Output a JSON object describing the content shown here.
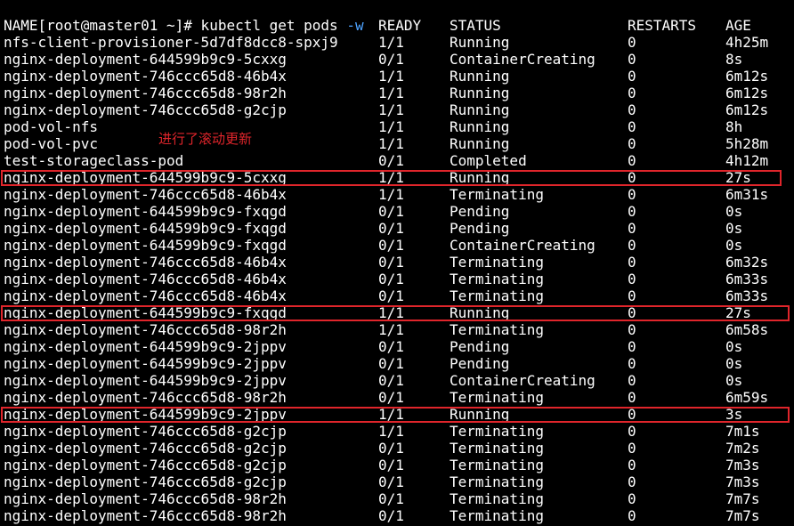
{
  "prompt": {
    "text": "[root@master01 ~]# kubectl get pods ",
    "flag": "-w"
  },
  "columns": {
    "name": "NAME",
    "ready": "READY",
    "status": "STATUS",
    "restarts": "RESTARTS",
    "age": "AGE"
  },
  "rows": [
    {
      "name": "nfs-client-provisioner-5d7df8dcc8-spxj9",
      "ready": "1/1",
      "status": "Running",
      "restarts": "0",
      "age": "4h25m"
    },
    {
      "name": "nginx-deployment-644599b9c9-5cxxg",
      "ready": "0/1",
      "status": "ContainerCreating",
      "restarts": "0",
      "age": "8s"
    },
    {
      "name": "nginx-deployment-746ccc65d8-46b4x",
      "ready": "1/1",
      "status": "Running",
      "restarts": "0",
      "age": "6m12s"
    },
    {
      "name": "nginx-deployment-746ccc65d8-98r2h",
      "ready": "1/1",
      "status": "Running",
      "restarts": "0",
      "age": "6m12s"
    },
    {
      "name": "nginx-deployment-746ccc65d8-g2cjp",
      "ready": "1/1",
      "status": "Running",
      "restarts": "0",
      "age": "6m12s"
    },
    {
      "name": "pod-vol-nfs",
      "ready": "1/1",
      "status": "Running",
      "restarts": "0",
      "age": "8h"
    },
    {
      "name": "pod-vol-pvc",
      "ready": "1/1",
      "status": "Running",
      "restarts": "0",
      "age": "5h28m"
    },
    {
      "name": "test-storageclass-pod",
      "ready": "0/1",
      "status": "Completed",
      "restarts": "0",
      "age": "4h12m"
    },
    {
      "name": "nginx-deployment-644599b9c9-5cxxg",
      "ready": "1/1",
      "status": "Running",
      "restarts": "0",
      "age": "27s"
    },
    {
      "name": "nginx-deployment-746ccc65d8-46b4x",
      "ready": "1/1",
      "status": "Terminating",
      "restarts": "0",
      "age": "6m31s"
    },
    {
      "name": "nginx-deployment-644599b9c9-fxqgd",
      "ready": "0/1",
      "status": "Pending",
      "restarts": "0",
      "age": "0s"
    },
    {
      "name": "nginx-deployment-644599b9c9-fxqgd",
      "ready": "0/1",
      "status": "Pending",
      "restarts": "0",
      "age": "0s"
    },
    {
      "name": "nginx-deployment-644599b9c9-fxqgd",
      "ready": "0/1",
      "status": "ContainerCreating",
      "restarts": "0",
      "age": "0s"
    },
    {
      "name": "nginx-deployment-746ccc65d8-46b4x",
      "ready": "0/1",
      "status": "Terminating",
      "restarts": "0",
      "age": "6m32s"
    },
    {
      "name": "nginx-deployment-746ccc65d8-46b4x",
      "ready": "0/1",
      "status": "Terminating",
      "restarts": "0",
      "age": "6m33s"
    },
    {
      "name": "nginx-deployment-746ccc65d8-46b4x",
      "ready": "0/1",
      "status": "Terminating",
      "restarts": "0",
      "age": "6m33s"
    },
    {
      "name": "nginx-deployment-644599b9c9-fxqgd",
      "ready": "1/1",
      "status": "Running",
      "restarts": "0",
      "age": "27s"
    },
    {
      "name": "nginx-deployment-746ccc65d8-98r2h",
      "ready": "1/1",
      "status": "Terminating",
      "restarts": "0",
      "age": "6m58s"
    },
    {
      "name": "nginx-deployment-644599b9c9-2jppv",
      "ready": "0/1",
      "status": "Pending",
      "restarts": "0",
      "age": "0s"
    },
    {
      "name": "nginx-deployment-644599b9c9-2jppv",
      "ready": "0/1",
      "status": "Pending",
      "restarts": "0",
      "age": "0s"
    },
    {
      "name": "nginx-deployment-644599b9c9-2jppv",
      "ready": "0/1",
      "status": "ContainerCreating",
      "restarts": "0",
      "age": "0s"
    },
    {
      "name": "nginx-deployment-746ccc65d8-98r2h",
      "ready": "0/1",
      "status": "Terminating",
      "restarts": "0",
      "age": "6m59s"
    },
    {
      "name": "nginx-deployment-644599b9c9-2jppv",
      "ready": "1/1",
      "status": "Running",
      "restarts": "0",
      "age": "3s"
    },
    {
      "name": "nginx-deployment-746ccc65d8-g2cjp",
      "ready": "1/1",
      "status": "Terminating",
      "restarts": "0",
      "age": "7m1s"
    },
    {
      "name": "nginx-deployment-746ccc65d8-g2cjp",
      "ready": "0/1",
      "status": "Terminating",
      "restarts": "0",
      "age": "7m2s"
    },
    {
      "name": "nginx-deployment-746ccc65d8-g2cjp",
      "ready": "0/1",
      "status": "Terminating",
      "restarts": "0",
      "age": "7m3s"
    },
    {
      "name": "nginx-deployment-746ccc65d8-g2cjp",
      "ready": "0/1",
      "status": "Terminating",
      "restarts": "0",
      "age": "7m3s"
    },
    {
      "name": "nginx-deployment-746ccc65d8-98r2h",
      "ready": "0/1",
      "status": "Terminating",
      "restarts": "0",
      "age": "7m7s"
    },
    {
      "name": "nginx-deployment-746ccc65d8-98r2h",
      "ready": "0/1",
      "status": "Terminating",
      "restarts": "0",
      "age": "7m7s"
    }
  ],
  "annotation": {
    "text": "进行了滚动更新"
  },
  "colors": {
    "background": "#000000",
    "text": "#ffffff",
    "flag": "#4da3ff",
    "annotation": "#e0252b",
    "highlight_box": "#e0252b"
  }
}
